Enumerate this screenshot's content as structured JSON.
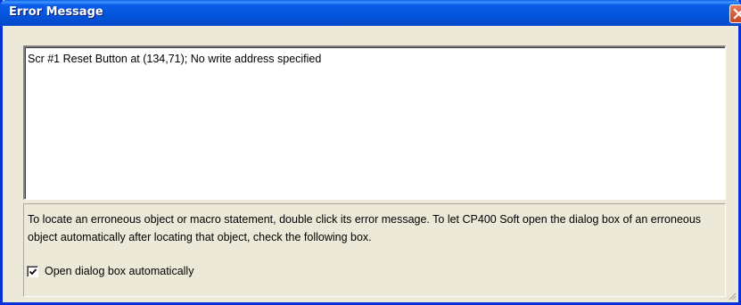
{
  "window": {
    "title": "Error Message",
    "close_icon": "close-icon"
  },
  "messages": [
    "Scr #1 Reset Button at (134,71); No write address specified"
  ],
  "info": {
    "text": "To locate an erroneous object or macro statement, double click its error message. To let CP400 Soft open the dialog box of an erroneous object automatically after locating that object, check the following box."
  },
  "auto_open": {
    "label": "Open dialog box automatically",
    "checked": true
  },
  "colors": {
    "titlebar": "#0454dc",
    "close_button": "#d8582f",
    "dialog_background": "#ece9d8"
  }
}
